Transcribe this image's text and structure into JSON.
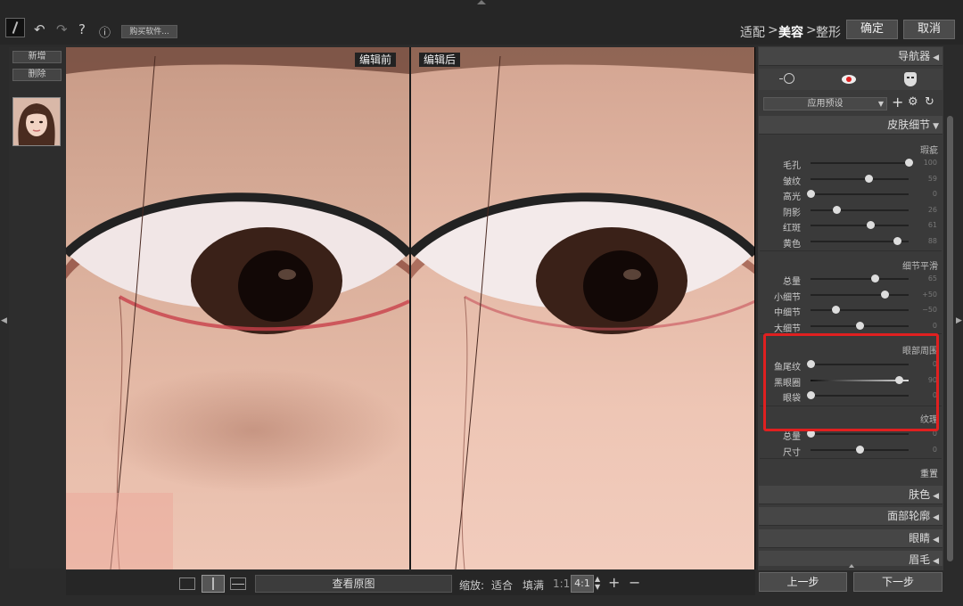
{
  "toolbar": {
    "buy_label": "购买软件...",
    "undo_icon": "undo-icon",
    "redo_icon": "redo-icon",
    "help_icon": "help-icon",
    "info_icon": "info-icon"
  },
  "breadcrumb": {
    "step1": "适配",
    "sep": ">",
    "step2": "美容",
    "step3": "整形"
  },
  "buttons": {
    "ok": "确定",
    "cancel": "取消"
  },
  "left": {
    "add": "新增",
    "delete": "删除"
  },
  "viewer": {
    "before": "编辑前",
    "after": "编辑后"
  },
  "bottom": {
    "show_original": "查看原图",
    "zoom_label": "缩放:",
    "fit": "适合",
    "fill": "填满",
    "one_to_one": "1:1",
    "zoom_value": "4:1",
    "plus": "+",
    "minus": "−"
  },
  "right": {
    "navigator": "导航器",
    "preset": "应用预设",
    "skin_detail": "皮肤细节",
    "group1_title": "瑕疵",
    "group2_title": "细节平滑",
    "group3_title": "眼部周围",
    "group4_title": "纹理",
    "reset": "重置",
    "skin_color": "肤色",
    "face_contour": "面部轮廓",
    "eyes": "眼睛",
    "eyebrows": "眉毛",
    "prev": "上一步",
    "next": "下一步",
    "sliders_group1": [
      {
        "label": "毛孔",
        "value": "100",
        "level": 1.0
      },
      {
        "label": "皱纹",
        "value": "59",
        "level": 0.59
      },
      {
        "label": "高光",
        "value": "0",
        "level": 0.0
      },
      {
        "label": "阴影",
        "value": "26",
        "level": 0.26
      },
      {
        "label": "红斑",
        "value": "61",
        "level": 0.61
      },
      {
        "label": "黄色",
        "value": "88",
        "level": 0.88
      }
    ],
    "sliders_group2": [
      {
        "label": "总量",
        "value": "65",
        "level": 0.65
      },
      {
        "label": "小细节",
        "value": "+50",
        "level": 0.75
      },
      {
        "label": "中细节",
        "value": "−50",
        "level": 0.25
      },
      {
        "label": "大细节",
        "value": "0",
        "level": 0.5
      }
    ],
    "sliders_group3": [
      {
        "label": "鱼尾纹",
        "value": "0",
        "level": 0.0
      },
      {
        "label": "黑眼圈",
        "value": "90",
        "level": 0.9
      },
      {
        "label": "眼袋",
        "value": "0",
        "level": 0.0
      }
    ],
    "sliders_group4": [
      {
        "label": "总量",
        "value": "0",
        "level": 0.0
      },
      {
        "label": "尺寸",
        "value": "0",
        "level": 0.5
      }
    ]
  },
  "colors": {
    "highlight_border": "#e02020",
    "panel_bg": "#3a3a3a",
    "header_bg": "#464646"
  }
}
